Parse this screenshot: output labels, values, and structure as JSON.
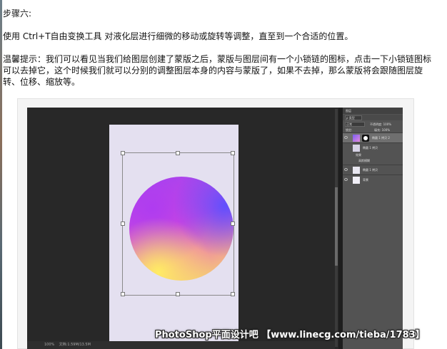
{
  "article": {
    "step_title": "步骤六:",
    "instruction": "使用 Ctrl+T自由变换工具 对液化层进行细微的移动或旋转等调整，直至到一个合适的位置。",
    "tip_line1": "温馨提示：我们可以看见当我们给图层创建了蒙版之后，蒙版与图层间有一个小锁链的图标，点击一下小锁链图标",
    "tip_line2": "可以去掉它，这个时候我们就可以分别的调整图层本身的内容与蒙版了，如果不去掉，那么蒙版将会跟随图层旋",
    "tip_line3": "转、位移、缩放等。"
  },
  "photoshop": {
    "status": "文档:1.59M/13.5M",
    "zoom": "100%",
    "layers_tab": "图层",
    "filter_label": "ρ 类型",
    "blend_mode": "正常",
    "opacity_label": "不透明度: 100%",
    "lock_label": "锁定:",
    "fill_label": "填充: 100%",
    "layers": [
      {
        "name": "椭圆 1 拷贝 2",
        "selected": true
      },
      {
        "name": "椭圆 1 拷贝",
        "selected": false
      },
      {
        "name": "效果",
        "selected": false
      },
      {
        "name": "高斯模糊",
        "selected": false
      },
      {
        "name": "椭圆 1 拷贝",
        "selected": false
      },
      {
        "name": "背景",
        "selected": false
      }
    ]
  },
  "watermark": "PhotoShop平面设计吧 【www.linecg.com/tieba/1783】",
  "colors": {
    "canvas_bg": "#e4e0f0",
    "workspace": "#282828",
    "panel": "#535353",
    "gradient_purple": "#9a45f2",
    "gradient_blue": "#5a50ff",
    "gradient_yellow": "#f5dc6a"
  }
}
